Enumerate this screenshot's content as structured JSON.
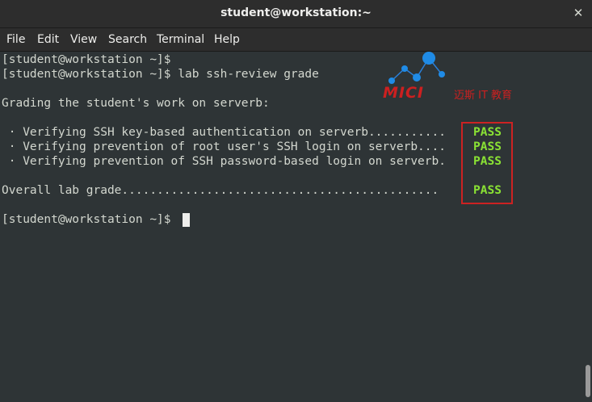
{
  "window": {
    "title": "student@workstation:~"
  },
  "menu": [
    "File",
    "Edit",
    "View",
    "Search",
    "Terminal",
    "Help"
  ],
  "terminal": {
    "lines": [
      "[student@workstation ~]$",
      "[student@workstation ~]$ lab ssh-review grade",
      "",
      "Grading the student's work on serverb:",
      "",
      " · Verifying SSH key-based authentication on serverb...........",
      " · Verifying prevention of root user's SSH login on serverb....",
      " · Verifying prevention of SSH password-based login on serverb.",
      "",
      "Overall lab grade.............................................",
      "",
      "[student@workstation ~]$"
    ],
    "results": [
      "PASS",
      "PASS",
      "PASS",
      "PASS"
    ]
  },
  "watermark": {
    "brand": "MICI",
    "subtitle": "迈斯 IT 教育"
  },
  "colors": {
    "pass": "#8ae234",
    "highlight": "#cc2222",
    "brand": "#cc2020"
  }
}
